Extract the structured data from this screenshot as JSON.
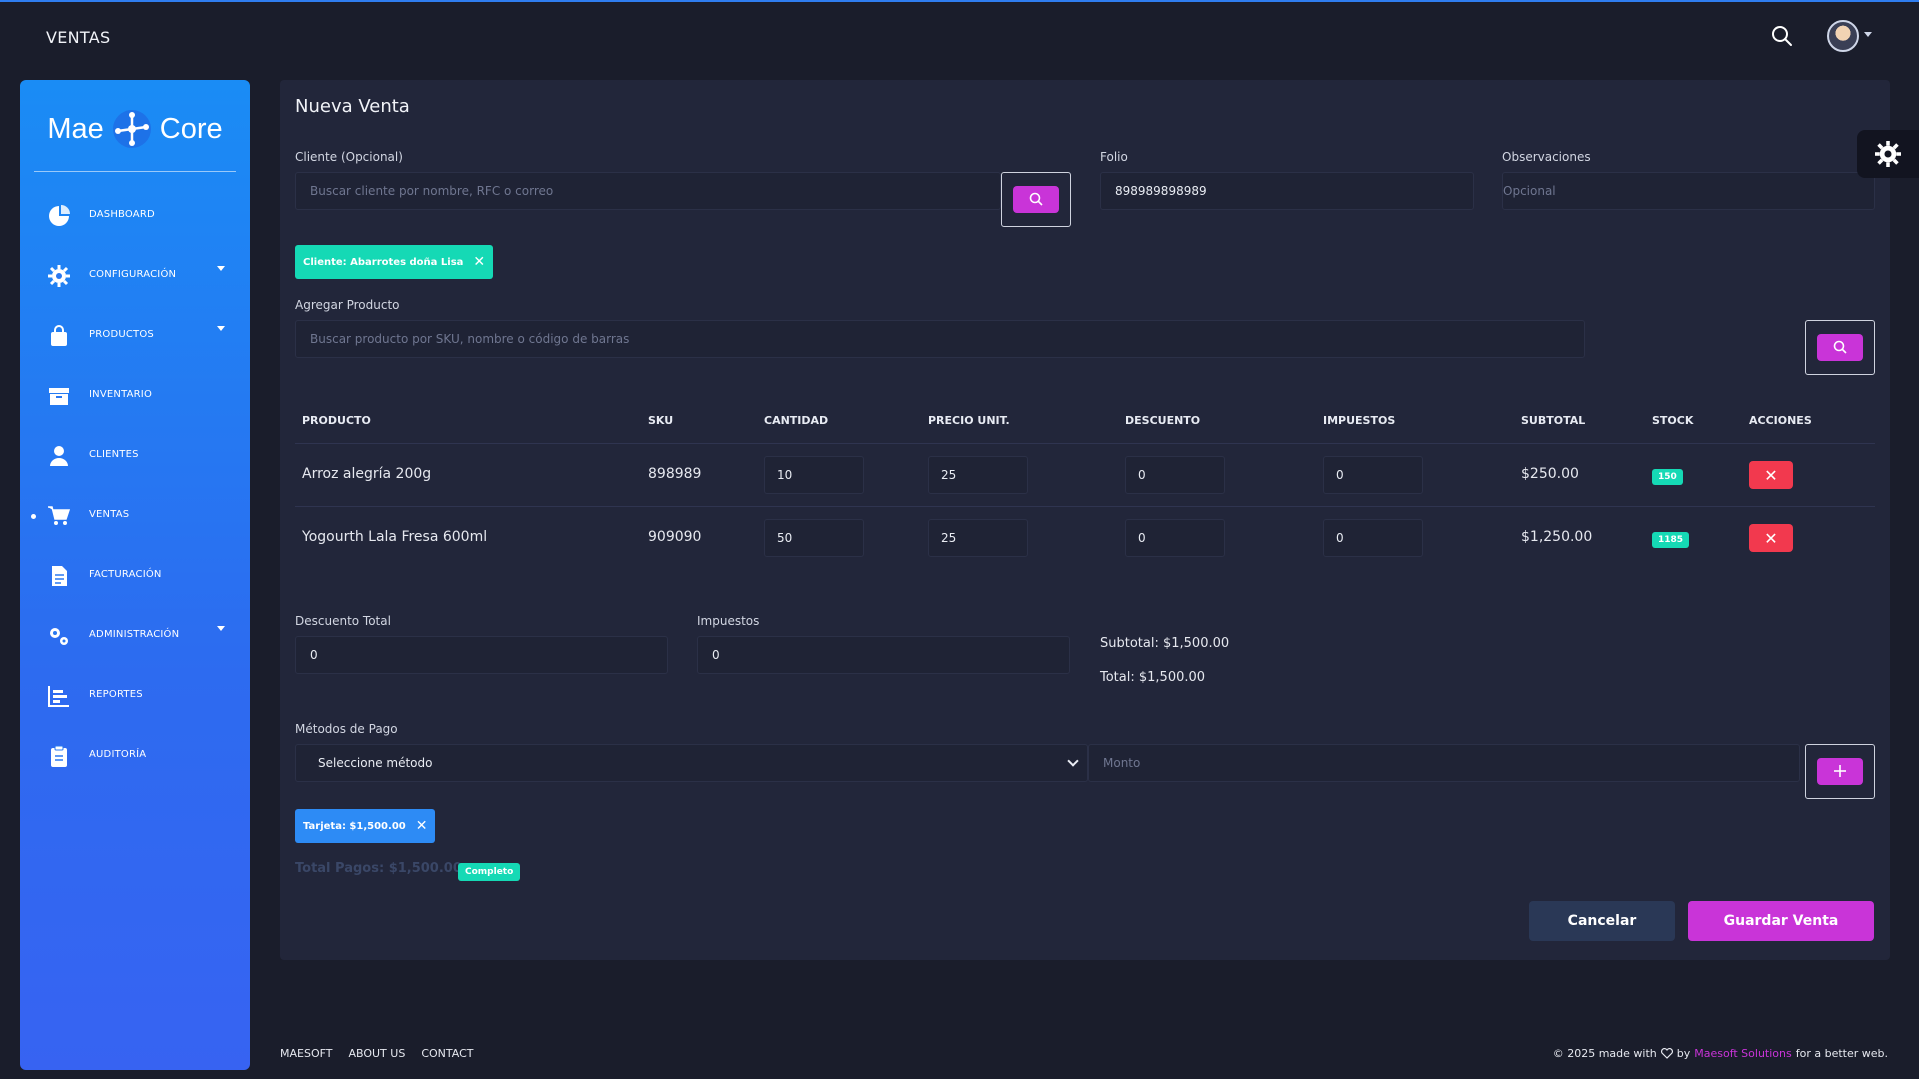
{
  "navbar": {
    "title": "VENTAS",
    "search_icon": "search-icon",
    "avatar_icon": "user-avatar"
  },
  "sidebar": {
    "brand_left": "Mae",
    "brand_right": "Core",
    "items": [
      {
        "label": "DASHBOARD",
        "icon": "pie-chart-icon"
      },
      {
        "label": "CONFIGURACIÓN",
        "icon": "gear-icon"
      },
      {
        "label": "PRODUCTOS",
        "icon": "shopping-bag-icon"
      },
      {
        "label": "INVENTARIO",
        "icon": "archive-icon"
      },
      {
        "label": "CLIENTES",
        "icon": "user-icon"
      },
      {
        "label": "VENTAS",
        "icon": "cart-icon"
      },
      {
        "label": "FACTURACIÓN",
        "icon": "invoice-icon"
      },
      {
        "label": "ADMINISTRACIÓN",
        "icon": "gears-icon"
      },
      {
        "label": "REPORTES",
        "icon": "bar-chart-icon"
      },
      {
        "label": "AUDITORÍA",
        "icon": "clipboard-icon"
      }
    ]
  },
  "form": {
    "title": "Nueva Venta",
    "client_label": "Cliente (Opcional)",
    "client_placeholder": "Buscar cliente por nombre, RFC o correo",
    "folio_label": "Folio",
    "folio_value": "898989898989",
    "obs_label": "Observaciones",
    "obs_placeholder": "Opcional",
    "client_chip": "Cliente: Abarrotes doña Lisa",
    "add_product_label": "Agregar Producto",
    "product_placeholder": "Buscar producto por SKU, nombre o código de barras"
  },
  "table": {
    "headers": {
      "product": "PRODUCTO",
      "sku": "SKU",
      "qty": "CANTIDAD",
      "price": "PRECIO UNIT.",
      "discount": "DESCUENTO",
      "tax": "IMPUESTOS",
      "subtotal": "SUBTOTAL",
      "stock": "STOCK",
      "actions": "ACCIONES"
    },
    "rows": [
      {
        "product": "Arroz alegría 200g",
        "sku": "898989",
        "qty": "10",
        "price": "25",
        "discount": "0",
        "tax": "0",
        "subtotal": "$250.00",
        "stock": "150"
      },
      {
        "product": "Yogourth Lala Fresa 600ml",
        "sku": "909090",
        "qty": "50",
        "price": "25",
        "discount": "0",
        "tax": "0",
        "subtotal": "$1,250.00",
        "stock": "1185"
      }
    ]
  },
  "totals": {
    "discount_label": "Descuento Total",
    "discount_value": "0",
    "tax_label": "Impuestos",
    "tax_value": "0",
    "subtotal": "Subtotal: $1,500.00",
    "total": "Total: $1,500.00"
  },
  "payments": {
    "label": "Métodos de Pago",
    "select_value": "Seleccione método",
    "amount_placeholder": "Monto",
    "chip": "Tarjeta: $1,500.00",
    "total_paid": "Total Pagos: $1,500.00",
    "status": "Completo"
  },
  "actions": {
    "cancel": "Cancelar",
    "save": "Guardar Venta"
  },
  "footer": {
    "links": [
      "MAESOFT",
      "ABOUT US",
      "CONTACT"
    ],
    "made_with": "© 2025 made with",
    "by": "by",
    "company": "Maesoft Solutions",
    "tail": "for a better web."
  },
  "colors": {
    "accent_magenta": "#c934d8",
    "accent_teal": "#15d9b5",
    "danger": "#f2394e",
    "sidebar_blue": "#1a8cf5",
    "background": "#1a1d2b"
  }
}
